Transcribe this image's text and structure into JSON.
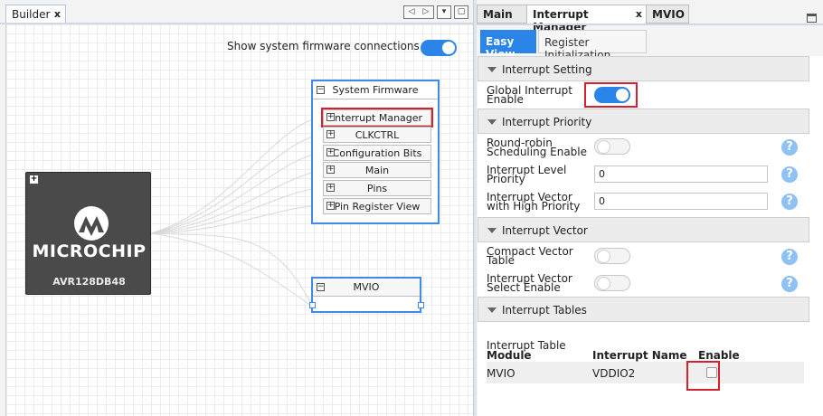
{
  "builder": {
    "tab_label": "Builder",
    "tab_close": "x",
    "nav_prev": "◁",
    "nav_next": "▷",
    "nav_dropdown": "▾",
    "nav_window": "▢",
    "fw_connections_label": "Show system firmware connections",
    "chip": {
      "brand": "MICROCHIP",
      "model": "AVR128DB48",
      "expand": "+"
    },
    "system_firmware": {
      "title": "System Firmware",
      "collapse": "−",
      "items": [
        {
          "label": "Interrupt Manager",
          "expand": "+"
        },
        {
          "label": "CLKCTRL",
          "expand": "+"
        },
        {
          "label": "Configuration Bits",
          "expand": "+"
        },
        {
          "label": "Main",
          "expand": "+"
        },
        {
          "label": "Pins",
          "expand": "+"
        },
        {
          "label": "Pin Register View",
          "expand": "+"
        }
      ]
    },
    "mvio_box": {
      "title": "MVIO",
      "collapse": "−"
    }
  },
  "panel": {
    "tabs": [
      {
        "label": "Main"
      },
      {
        "label": "Interrupt Manager",
        "close": "x"
      },
      {
        "label": "MVIO"
      }
    ],
    "subtabs": {
      "easy_view": "Easy View",
      "register_init": "Register Initialization"
    },
    "sections": {
      "interrupt_setting": "Interrupt Setting",
      "interrupt_priority": "Interrupt Priority",
      "interrupt_vector": "Interrupt Vector",
      "interrupt_tables": "Interrupt Tables"
    },
    "fields": {
      "global_interrupt_l1": "Global Interrupt",
      "global_interrupt_l2": "Enable",
      "round_robin_l1": "Round-robin",
      "round_robin_l2": "Scheduling Enable",
      "level_priority_l1": "Interrupt Level",
      "level_priority_l2": "Priority",
      "level_priority_value": "0",
      "vector_high_l1": "Interrupt Vector",
      "vector_high_l2": "with High Priority",
      "vector_high_value": "0",
      "compact_l1": "Compact Vector",
      "compact_l2": "Table",
      "select_l1": "Interrupt Vector",
      "select_l2": "Select Enable"
    },
    "help_icon": "?",
    "table": {
      "title": "Interrupt Table",
      "headers": {
        "module": "Module",
        "interrupt_name": "Interrupt Name",
        "enable": "Enable"
      },
      "rows": [
        {
          "module": "MVIO",
          "interrupt_name": "VDDIO2",
          "enabled": false
        }
      ]
    }
  },
  "colors": {
    "accent": "#2b84e8",
    "highlight": "#d4202f",
    "chip_body": "#4a4a4a"
  }
}
